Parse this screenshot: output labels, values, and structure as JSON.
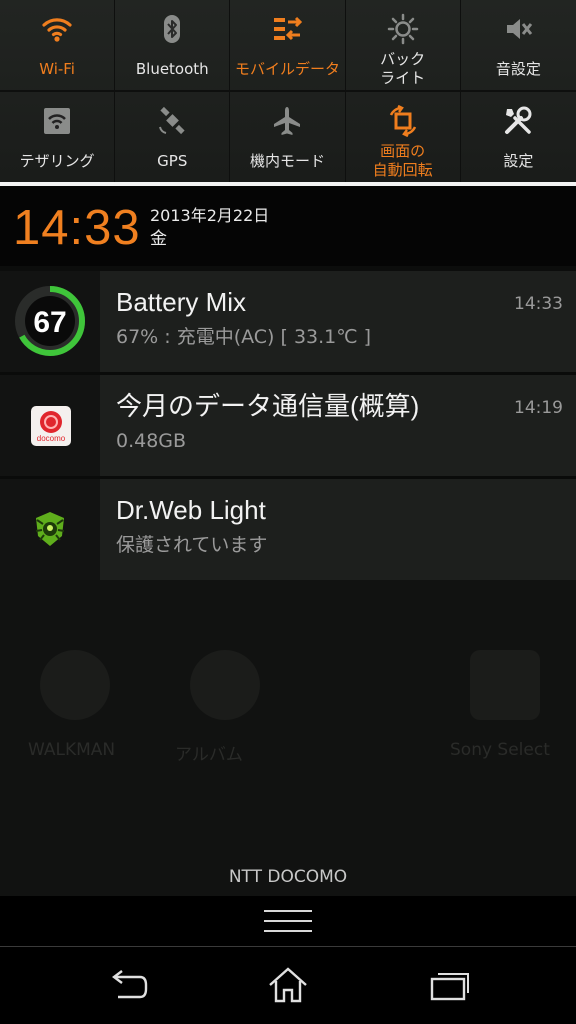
{
  "quick_settings": {
    "row1": [
      {
        "label": "Wi-Fi",
        "icon": "wifi-icon",
        "active": true
      },
      {
        "label": "Bluetooth",
        "icon": "bluetooth-icon",
        "active": false
      },
      {
        "label": "モバイルデータ",
        "icon": "mobile-data-icon",
        "active": true
      },
      {
        "label": "バック\nライト",
        "icon": "backlight-icon",
        "active": false
      },
      {
        "label": "音設定",
        "icon": "sound-settings-icon",
        "active": false
      }
    ],
    "row2": [
      {
        "label": "テザリング",
        "icon": "tethering-icon",
        "active": false
      },
      {
        "label": "GPS",
        "icon": "gps-icon",
        "active": false
      },
      {
        "label": "機内モード",
        "icon": "airplane-mode-icon",
        "active": false
      },
      {
        "label": "画面の\n自動回転",
        "icon": "auto-rotate-icon",
        "active": true
      },
      {
        "label": "設定",
        "icon": "settings-tools-icon",
        "active": false
      }
    ]
  },
  "header": {
    "time": "14:33",
    "date": "2013年2月22日",
    "weekday": "金"
  },
  "notifications": [
    {
      "title": "Battery Mix",
      "subtitle": "67% : 充電中(AC) [ 33.1℃ ]",
      "time": "14:33",
      "icon": "battery-mix-icon",
      "badge": "67",
      "battery_percent": 67
    },
    {
      "title": "今月のデータ通信量(概算)",
      "subtitle": "0.48GB",
      "time": "14:19",
      "icon": "docomo-icon",
      "badge": "docomo"
    },
    {
      "title": "Dr.Web Light",
      "subtitle": "保護されています",
      "time": "",
      "icon": "drweb-spider-icon"
    }
  ],
  "wallpaper_labels": [
    "WALKMAN",
    "アルバム",
    "Sony Select"
  ],
  "carrier": "NTT DOCOMO",
  "colors": {
    "accent": "#f07e1e",
    "active_label": "#f07e1e",
    "battery_ring": "#3fc53a"
  },
  "nav": {
    "back": "back-icon",
    "home": "home-icon",
    "recents": "recent-apps-icon"
  }
}
